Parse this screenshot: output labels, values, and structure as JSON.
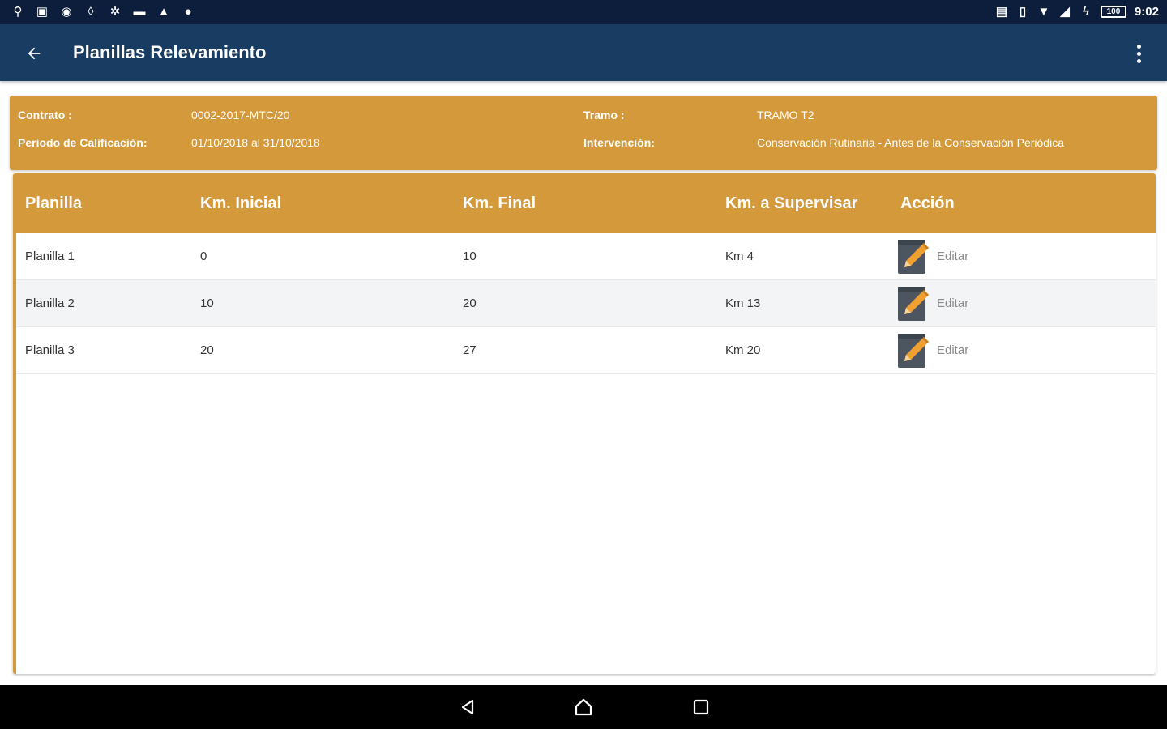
{
  "status_bar": {
    "time": "9:02",
    "battery": "100",
    "icons_left": [
      "usb-icon",
      "chat-icon",
      "message-icon",
      "alarm-icon",
      "usb-debug-icon",
      "folder-icon",
      "warning-icon",
      "location-icon"
    ],
    "icons_right": [
      "cast-icon",
      "vibrate-icon",
      "wifi-icon",
      "signal-icon",
      "battery-charging-icon"
    ]
  },
  "app_bar": {
    "title": "Planillas Relevamiento"
  },
  "info": {
    "contrato_label": "Contrato :",
    "contrato_value": "0002-2017-MTC/20",
    "periodo_label": "Periodo de Calificación:",
    "periodo_value": "01/10/2018 al 31/10/2018",
    "tramo_label": "Tramo :",
    "tramo_value": "TRAMO T2",
    "intervencion_label": "Intervención:",
    "intervencion_value": "Conservación Rutinaria - Antes de la Conservación Periódica"
  },
  "table": {
    "headers": [
      "Planilla",
      "Km. Inicial",
      "Km. Final",
      "Km. a Supervisar",
      "Acción"
    ],
    "rows": [
      {
        "planilla": "Planilla 1",
        "km_inicial": "0",
        "km_final": "10",
        "km_supervisar": "Km  4",
        "accion": "Editar"
      },
      {
        "planilla": "Planilla 2",
        "km_inicial": "10",
        "km_final": "20",
        "km_supervisar": "Km  13",
        "accion": "Editar"
      },
      {
        "planilla": "Planilla 3",
        "km_inicial": "20",
        "km_final": "27",
        "km_supervisar": "Km  20",
        "accion": "Editar"
      }
    ]
  },
  "colors": {
    "status_bar": "#0d1e3c",
    "app_bar": "#183c62",
    "accent": "#d4993a",
    "pencil": "#f0a030",
    "notepad": "#4d5660"
  },
  "nav_bar": {
    "buttons": [
      "back-triangle-icon",
      "home-icon",
      "recents-icon"
    ]
  }
}
